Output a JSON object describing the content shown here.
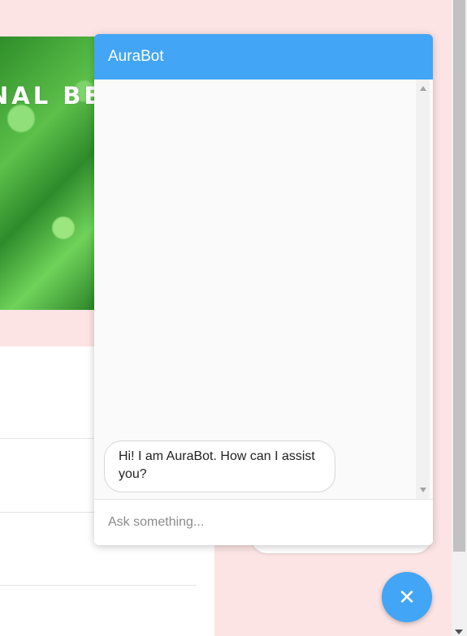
{
  "hero": {
    "banner_text": "NAL BE"
  },
  "chat": {
    "title": "AuraBot",
    "messages": [
      {
        "sender": "bot",
        "text": "Hi! I am AuraBot. How can I assist you?"
      }
    ],
    "input_placeholder": "Ask something...",
    "input_value": ""
  },
  "fab": {
    "icon": "close-icon",
    "glyph": "✕"
  },
  "colors": {
    "accent": "#42a5f5",
    "page_background": "#fce4e4",
    "chat_background": "#fafafa"
  }
}
